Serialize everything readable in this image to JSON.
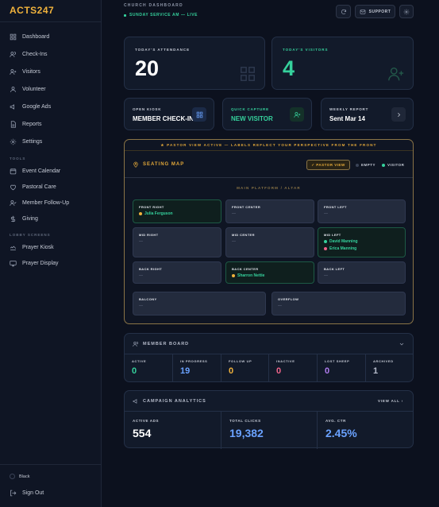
{
  "brand": "ACTS247",
  "sidebar": {
    "items": [
      {
        "label": "Dashboard",
        "icon": "grid-icon"
      },
      {
        "label": "Check-Ins",
        "icon": "users-icon"
      },
      {
        "label": "Visitors",
        "icon": "user-plus-icon"
      },
      {
        "label": "Volunteer",
        "icon": "user-icon"
      },
      {
        "label": "Google Ads",
        "icon": "megaphone-icon"
      },
      {
        "label": "Reports",
        "icon": "file-icon"
      },
      {
        "label": "Settings",
        "icon": "gear-icon"
      }
    ],
    "tools_label": "TOOLS",
    "tools": [
      {
        "label": "Event Calendar",
        "icon": "calendar-icon"
      },
      {
        "label": "Pastoral Care",
        "icon": "heart-icon"
      },
      {
        "label": "Member Follow-Up",
        "icon": "user-check-icon"
      },
      {
        "label": "Giving",
        "icon": "dollar-icon"
      }
    ],
    "lobby_label": "LOBBY SCREENS",
    "lobby": [
      {
        "label": "Prayer Kiosk",
        "icon": "hands-icon"
      },
      {
        "label": "Prayer Display",
        "icon": "monitor-icon"
      }
    ],
    "theme_label": "Black",
    "signout_label": "Sign Out"
  },
  "header": {
    "eyebrow": "CHURCH DASHBOARD",
    "live_text": "SUNDAY SERVICE AM — LIVE",
    "support_label": "SUPPORT"
  },
  "stats": {
    "attendance_label": "TODAY'S ATTENDANCE",
    "attendance_value": "20",
    "visitors_label": "TODAY'S VISITORS",
    "visitors_value": "4"
  },
  "quick_actions": [
    {
      "label": "OPEN KIOSK",
      "value": "MEMBER CHECK-IN",
      "color": "#ffffff"
    },
    {
      "label": "QUICK CAPTURE",
      "value": "NEW VISITOR",
      "color": "#35d19c"
    },
    {
      "label": "WEEKLY REPORT",
      "value": "Sent Mar 14",
      "color": "#ffffff"
    }
  ],
  "seating": {
    "banner": "★ PASTOR VIEW ACTIVE — LABELS REFLECT YOUR PERSPECTIVE FROM THE FRONT",
    "title": "SEATING MAP",
    "pastor_view_label": "✓ PASTOR VIEW",
    "legend_empty": "EMPTY",
    "legend_visitor": "VISITOR",
    "platform": "MAIN PLATFORM / ALTAR",
    "empty_marker": "—",
    "zones": {
      "front_right": {
        "name": "FRONT RIGHT",
        "people": [
          "Julia Ferguson"
        ]
      },
      "front_center": {
        "name": "FRONT CENTER"
      },
      "front_left": {
        "name": "FRONT LEFT"
      },
      "mid_right": {
        "name": "MID RIGHT"
      },
      "mid_center": {
        "name": "MID CENTER"
      },
      "mid_left": {
        "name": "MID LEFT",
        "people": [
          "David Manning",
          "Erica Manning"
        ]
      },
      "back_right": {
        "name": "BACK RIGHT"
      },
      "back_center": {
        "name": "BACK CENTER",
        "people": [
          "Sharron Nettie"
        ]
      },
      "back_left": {
        "name": "BACK LEFT"
      },
      "balcony": {
        "name": "BALCONY"
      },
      "overflow": {
        "name": "OVERFLOW"
      }
    }
  },
  "member_board": {
    "title": "MEMBER BOARD",
    "columns": [
      {
        "label": "ACTIVE",
        "value": "0",
        "color": "#35d19c"
      },
      {
        "label": "IN PROGRESS",
        "value": "19",
        "color": "#6aa2ff"
      },
      {
        "label": "FOLLOW UP",
        "value": "0",
        "color": "#f0b23c"
      },
      {
        "label": "INACTIVE",
        "value": "0",
        "color": "#f0648a"
      },
      {
        "label": "LOST SHEEP",
        "value": "0",
        "color": "#b07cf0"
      },
      {
        "label": "ARCHIVED",
        "value": "1",
        "color": "#b6bccb"
      }
    ]
  },
  "campaign": {
    "title": "CAMPAIGN ANALYTICS",
    "view_all": "VIEW ALL ›",
    "columns": [
      {
        "label": "ACTIVE ADS",
        "value": "554",
        "color": "#ffffff"
      },
      {
        "label": "TOTAL CLICKS",
        "value": "19,382",
        "color": "#6aa2ff"
      },
      {
        "label": "AVG. CTR",
        "value": "2.45%",
        "color": "#6aa2ff"
      }
    ]
  }
}
